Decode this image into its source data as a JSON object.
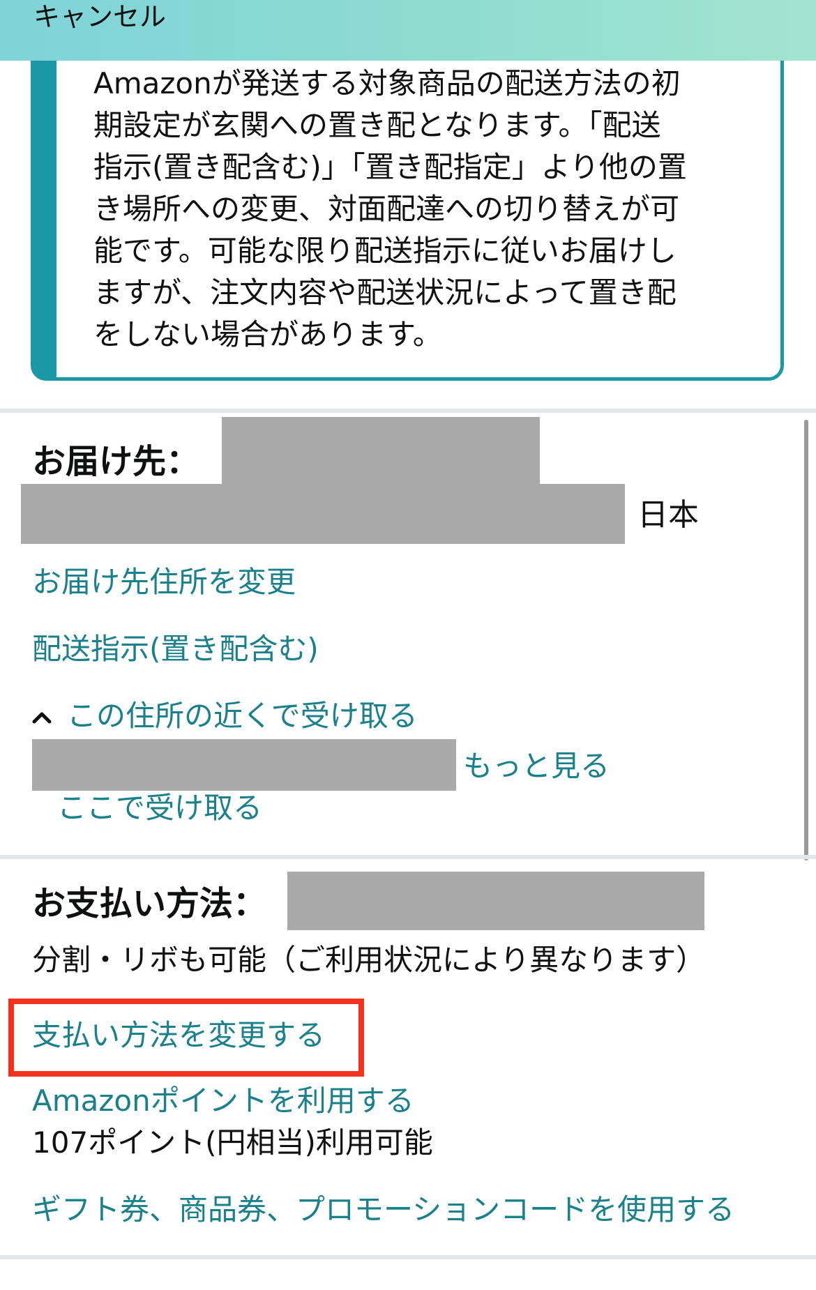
{
  "header": {
    "cancel_label": "キャンセル"
  },
  "notice": {
    "text": "Amazonが発送する対象商品の配送方法の初\n期設定が玄関への置き配となります。「配送\n指示(置き配含む)」「置き配指定」より他の置\nき場所への変更、対面配達への切り替えが可\n能です。可能な限り配送指示に従いお届けし\nますが、注文内容や配送状況によって置き配\nをしない場合があります。"
  },
  "shipping": {
    "heading": "お届け先：",
    "country": "日本",
    "change_address_link": "お届け先住所を変更",
    "delivery_instructions_link": "配送指示(置き配含む)",
    "pickup_toggle_link": "この住所の近くで受け取る",
    "see_more_link": "もっと見る",
    "pickup_here_link": "ここで受け取る"
  },
  "payment": {
    "heading": "お支払い方法：",
    "installment_note": "分割・リボも可能（ご利用状況により異なります）",
    "change_payment_link": "支払い方法を変更する",
    "points_link": "Amazonポイントを利用する",
    "points_available": "107ポイント(円相当)利用可能",
    "gift_link": "ギフト券、商品券、プロモーションコードを使用する"
  },
  "colors": {
    "header_gradient_start": "#7fd3d9",
    "header_gradient_end": "#a3e4d1",
    "accent_teal": "#1b98a6",
    "link_color": "#19808c",
    "highlight_red": "#f2321d",
    "redaction_gray": "#a9a9a9"
  },
  "icons": {
    "pickup_toggle": "chevron-up-icon"
  }
}
